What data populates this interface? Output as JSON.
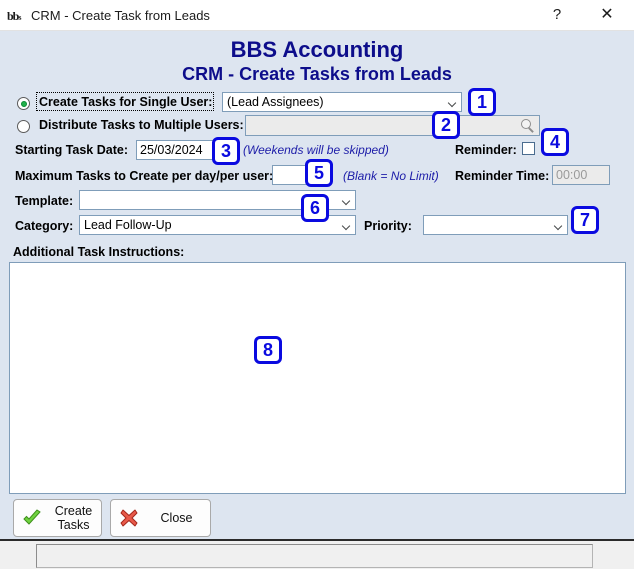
{
  "window": {
    "title": "CRM - Create Task from Leads",
    "icon": "app-logo-icon",
    "help_label": "?",
    "close_label": "✕"
  },
  "header": {
    "line1": "BBS Accounting",
    "line2": "CRM - Create Tasks from Leads",
    "color": "#0d0d8b"
  },
  "form": {
    "single_user_label": "Create Tasks for Single User:",
    "single_user_selected": true,
    "multiple_users_label": "Distribute Tasks to Multiple Users:",
    "multiple_users_selected": false,
    "assignee_value": "(Lead Assignees)",
    "multi_user_value": "",
    "multi_user_enabled": false,
    "starting_date_label": "Starting Task Date:",
    "starting_date_value": "25/03/2024",
    "weekends_note": "(Weekends will be skipped)",
    "reminder_label": "Reminder:",
    "reminder_checked": false,
    "reminder_time_label": "Reminder Time:",
    "reminder_time_value": "00:00",
    "reminder_time_enabled": false,
    "max_tasks_label": "Maximum Tasks to Create per day/per user:",
    "max_tasks_value": "",
    "max_tasks_note": "(Blank = No Limit)",
    "template_label": "Template:",
    "template_value": "",
    "category_label": "Category:",
    "category_value": "Lead Follow-Up",
    "priority_label": "Priority:",
    "priority_value": "",
    "instructions_label": "Additional Task Instructions:",
    "instructions_value": ""
  },
  "buttons": {
    "create_tasks_line1": "Create",
    "create_tasks_line2": "Tasks",
    "close": "Close"
  },
  "status": {
    "text": ""
  },
  "annotations": [
    {
      "n": "1"
    },
    {
      "n": "2"
    },
    {
      "n": "3"
    },
    {
      "n": "4"
    },
    {
      "n": "5"
    },
    {
      "n": "6"
    },
    {
      "n": "7"
    },
    {
      "n": "8"
    }
  ]
}
